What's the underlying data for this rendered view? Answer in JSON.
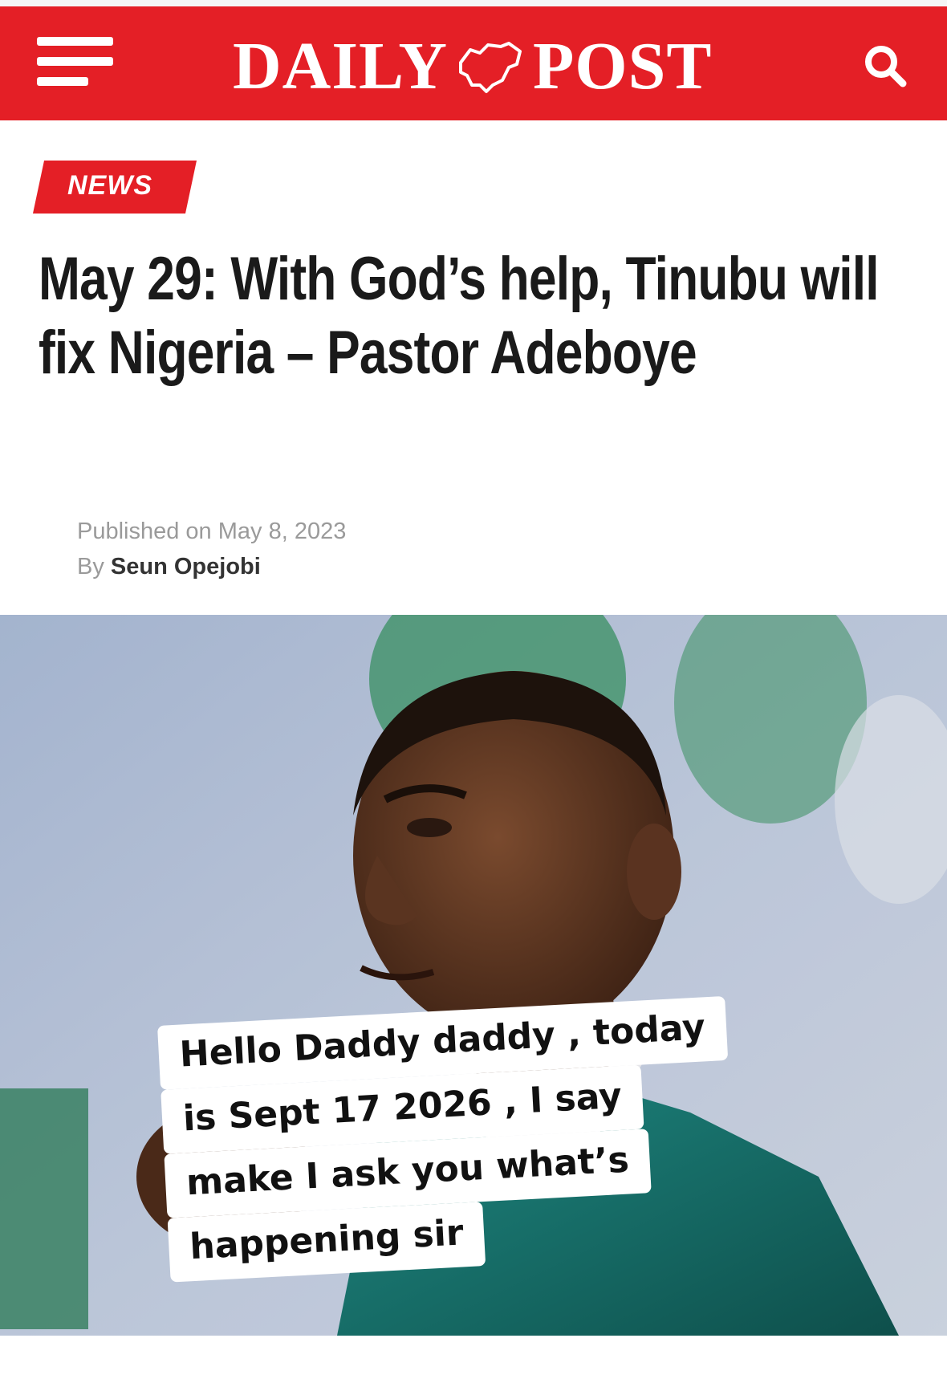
{
  "header": {
    "brand_left": "DAILY",
    "brand_right": "POST",
    "menu_icon": "hamburger-menu-icon",
    "search_icon": "search-icon",
    "colors": {
      "brand_red": "#e41f26",
      "text_white": "#ffffff"
    }
  },
  "article": {
    "category": "NEWS",
    "headline": "May 29: With God’s help, Tinubu will fix Nigeria – Pastor Adeboye",
    "published": "Published on May 8, 2023",
    "by_label": "By",
    "author": "Seun Opejobi"
  },
  "overlay": {
    "lines": [
      "Hello Daddy daddy , today",
      "is Sept 17 2026 , I say",
      "make I ask you what’s",
      "happening sir"
    ]
  }
}
